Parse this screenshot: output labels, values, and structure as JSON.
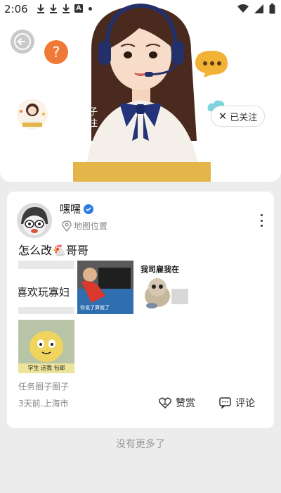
{
  "status_bar": {
    "time": "2:06",
    "left_icons": [
      "download-icon",
      "download-icon",
      "download-icon",
      "a-icon",
      "dot-icon"
    ],
    "right_icons": [
      "wifi-icon",
      "signal-icon",
      "battery-icon"
    ]
  },
  "header": {
    "back_icon": "back-arrow-icon",
    "follow_button": {
      "icon": "close-icon",
      "label": "已关注"
    },
    "background_name": "子\n注"
  },
  "post": {
    "username": "嘿嘿",
    "verified_icon": "verified-icon",
    "location": "地图位置",
    "text": "怎么改🐔哥哥",
    "images": [
      {
        "caption": "喜欢玩寡妇"
      },
      {
        "caption": "你说了算就了"
      },
      {
        "caption": "我司雇我在"
      },
      {
        "caption": "学生 送我 包邮"
      }
    ],
    "circle_tag": "任务圈子圈子",
    "time_location": "3天前.上海市",
    "reward_label": "赞赏",
    "comment_label": "评论"
  },
  "footer": {
    "no_more": "没有更多了"
  },
  "colors": {
    "page_bg": "#ececec",
    "card_bg": "#ffffff",
    "verified": "#2c7be5",
    "muted_text": "#888888"
  }
}
